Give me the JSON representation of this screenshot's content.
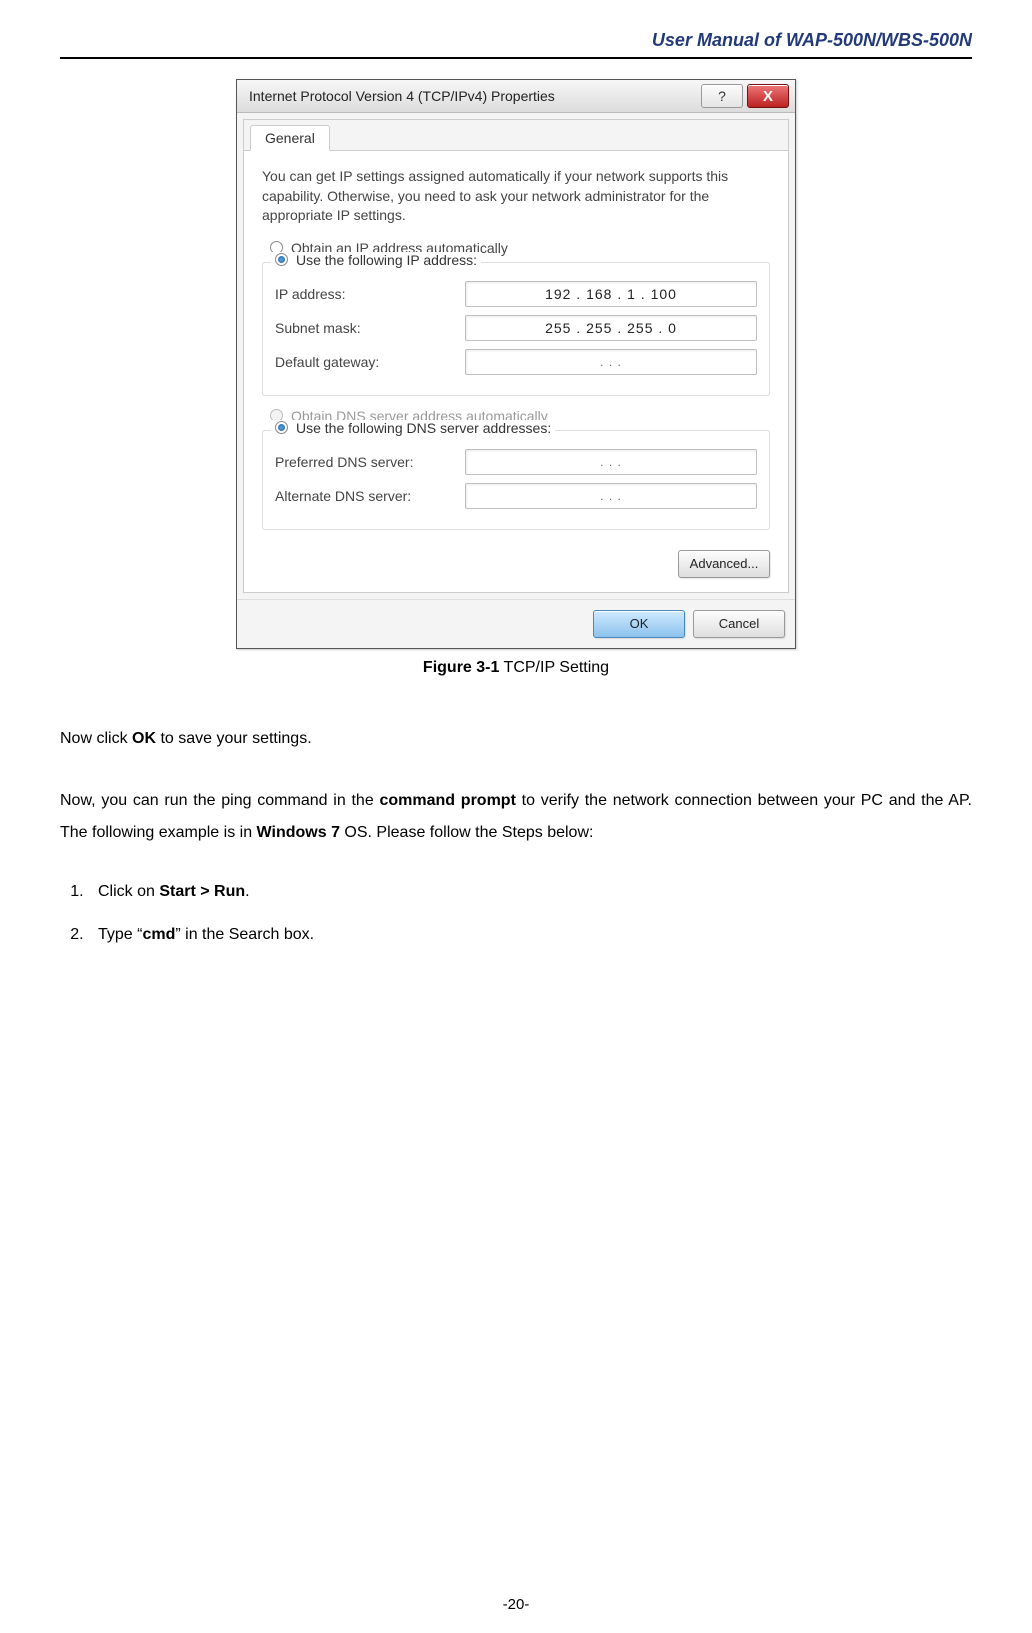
{
  "header": {
    "title": "User Manual of WAP-500N/WBS-500N"
  },
  "dialog": {
    "title": "Internet Protocol Version 4 (TCP/IPv4) Properties",
    "help_icon": "?",
    "close_icon": "X",
    "tab_label": "General",
    "explain": "You can get IP settings assigned automatically if your network supports this capability. Otherwise, you need to ask your network administrator for the appropriate IP settings.",
    "radios": {
      "obtain_ip": "Obtain an IP address automatically",
      "use_ip": "Use the following IP address:",
      "obtain_dns": "Obtain DNS server address automatically",
      "use_dns": "Use the following DNS server addresses:"
    },
    "fields": {
      "ip_label": "IP address:",
      "ip_value": "192 . 168 .   1   . 100",
      "subnet_label": "Subnet mask:",
      "subnet_value": "255 . 255 . 255 .   0",
      "gateway_label": "Default gateway:",
      "gateway_value": ".       .       .",
      "pref_dns_label": "Preferred DNS server:",
      "pref_dns_value": ".       .       .",
      "alt_dns_label": "Alternate DNS server:",
      "alt_dns_value": ".       .       ."
    },
    "buttons": {
      "advanced": "Advanced...",
      "ok": "OK",
      "cancel": "Cancel"
    }
  },
  "figure": {
    "label": "Figure 3-1",
    "caption": " TCP/IP Setting"
  },
  "text": {
    "line1_a": "Now click ",
    "line1_b": "OK",
    "line1_c": " to save your settings.",
    "line2_a": "Now, you can run the ping command in the ",
    "line2_b": "command prompt",
    "line2_c": " to verify the network connection between your PC and the AP. The following example is in ",
    "line2_d": "Windows 7",
    "line2_e": " OS. Please follow the Steps below:",
    "step1_a": "Click on ",
    "step1_b": "Start > Run",
    "step1_c": ".",
    "step2_a": "Type “",
    "step2_b": "cmd",
    "step2_c": "” in the Search box."
  },
  "page_number": "-20-"
}
